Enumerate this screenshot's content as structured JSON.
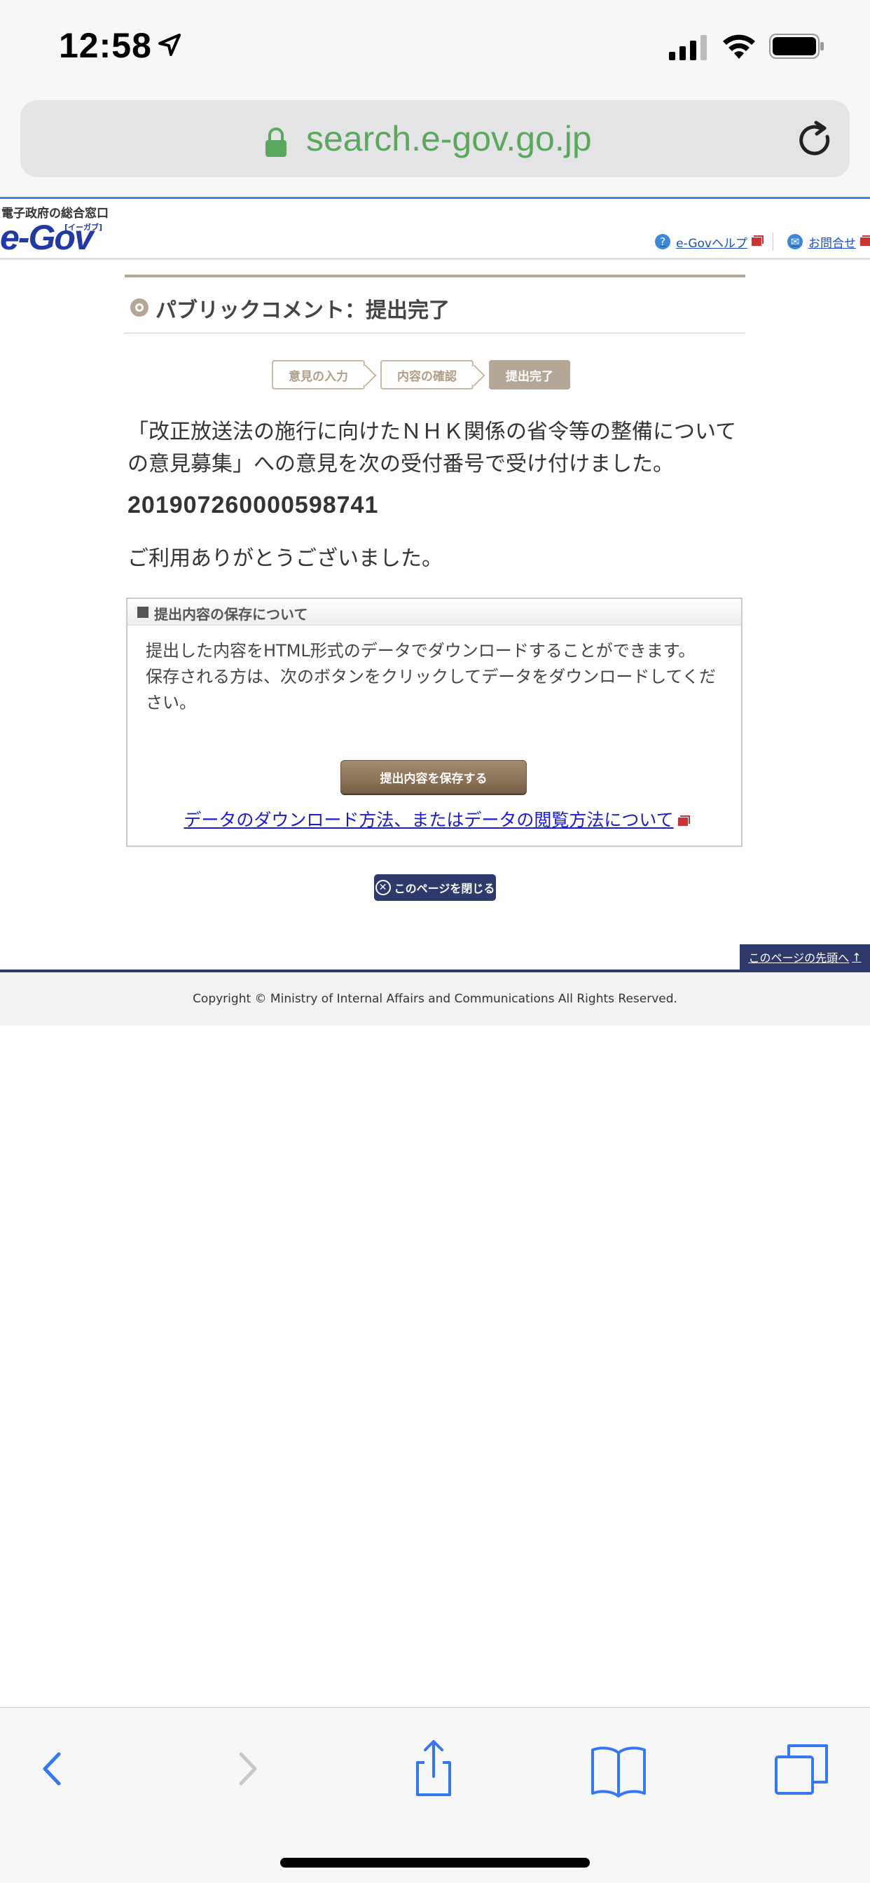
{
  "status": {
    "time": "12:58"
  },
  "browser": {
    "url": "search.e-gov.go.jp"
  },
  "header": {
    "logo_caption": "電子政府の総合窓口",
    "logo_text": "e-Gov",
    "logo_reading": "[イーガブ]",
    "help_link": "e-Govヘルプ",
    "contact_link": "お問合せ"
  },
  "page": {
    "title": "パブリックコメント：提出完了",
    "steps": [
      "意見の入力",
      "内容の確認",
      "提出完了"
    ],
    "message": "「改正放送法の施行に向けたＮＨＫ関係の省令等の整備についての意見募集」への意見を次の受付番号で受け付けました。",
    "receipt_number": "201907260000598741",
    "thanks": "ご利用ありがとうございました。"
  },
  "save_section": {
    "heading": "提出内容の保存について",
    "line1": "提出した内容をHTML形式のデータでダウンロードすることができます。",
    "line2": "保存される方は、次のボタンをクリックしてデータをダウンロードしてください。",
    "button": "提出内容を保存する",
    "link": "データのダウンロード方法、またはデータの閲覧方法について"
  },
  "close_button": "このページを閉じる",
  "to_top": "このページの先頭へ",
  "footer": {
    "copyright": "Copyright © Ministry of Internal Affairs and Communications All Rights Reserved."
  },
  "colors": {
    "accent_blue": "#2f8ee0",
    "navy": "#2d3a6b",
    "beige": "#b5a795",
    "url_green": "#5aa85d"
  }
}
